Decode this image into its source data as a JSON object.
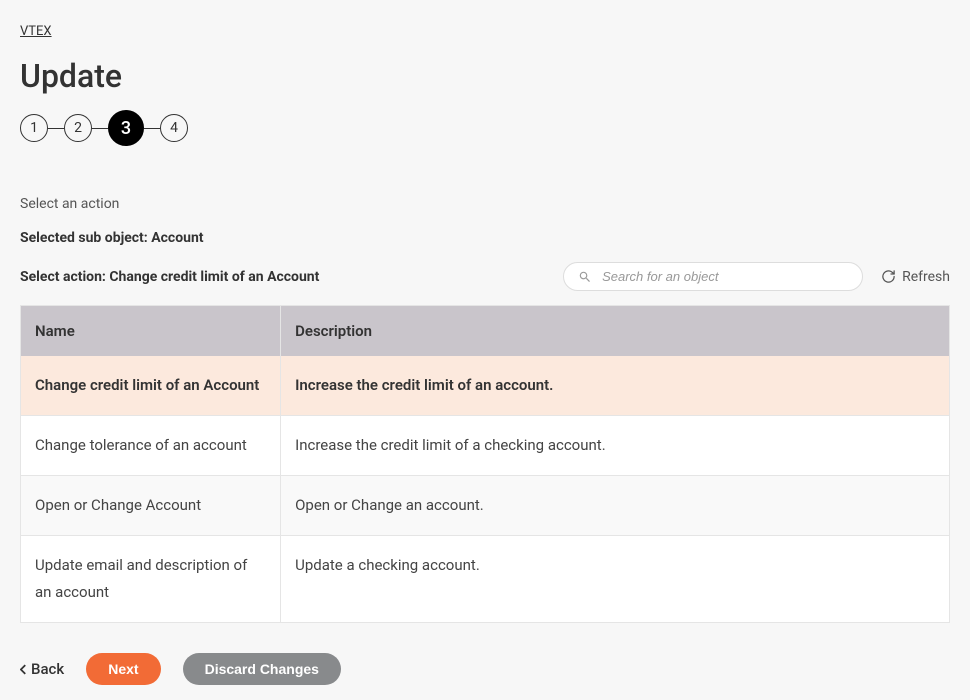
{
  "breadcrumb": "VTEX",
  "title": "Update",
  "stepper": {
    "steps": [
      "1",
      "2",
      "3",
      "4"
    ],
    "activeIndex": 2
  },
  "section_label": "Select an action",
  "selected_sub_object_line": "Selected sub object: Account",
  "select_action_line": "Select action: Change credit limit of an Account",
  "search": {
    "placeholder": "Search for an object"
  },
  "refresh_label": "Refresh",
  "table": {
    "headers": {
      "name": "Name",
      "description": "Description"
    },
    "rows": [
      {
        "name": "Change credit limit of an Account",
        "description": "Increase the credit limit of an account.",
        "selected": true
      },
      {
        "name": "Change tolerance of an account",
        "description": "Increase the credit limit of a checking account.",
        "selected": false
      },
      {
        "name": "Open or Change Account",
        "description": "Open or Change an account.",
        "selected": false
      },
      {
        "name": "Update email and description of an account",
        "description": "Update a checking account.",
        "selected": false
      }
    ]
  },
  "footer": {
    "back": "Back",
    "next": "Next",
    "discard": "Discard Changes"
  }
}
